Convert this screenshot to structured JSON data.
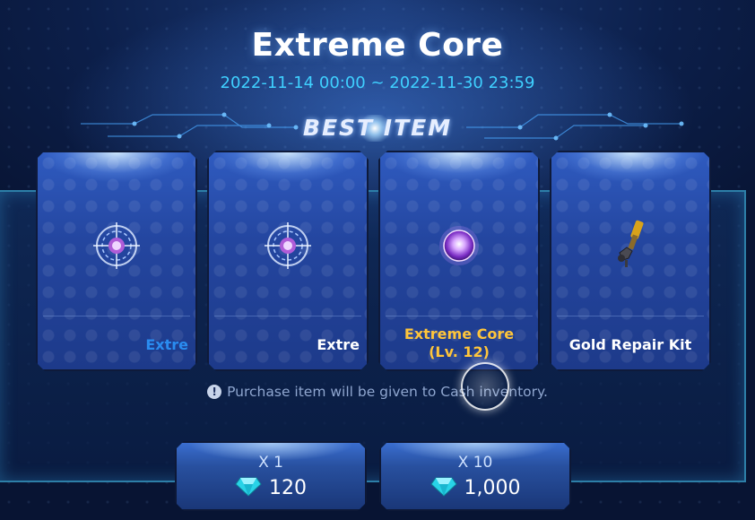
{
  "event": {
    "title": "Extreme Core",
    "period": "2022-11-14 00:00 ~ 2022-11-30 23:59",
    "section_heading": "BEST ITEM"
  },
  "items": [
    {
      "name": "Extre",
      "icon": "core-emblem-icon",
      "name_color": "#2a8cf0"
    },
    {
      "name": "Extre",
      "icon": "core-emblem-icon",
      "name_color": "#ffffff"
    },
    {
      "name": "Extreme Core (Lv. 12)",
      "icon": "purple-orb-icon",
      "name_color": "#ffc53a"
    },
    {
      "name": "Gold Repair Kit",
      "icon": "repair-kit-icon",
      "name_color": "#ffffff"
    }
  ],
  "notice": "Purchase item will be given to Cash inventory.",
  "purchase_options": [
    {
      "quantity": "X 1",
      "price": "120",
      "currency_icon": "diamond-gem-icon"
    },
    {
      "quantity": "X 10",
      "price": "1,000",
      "currency_icon": "diamond-gem-icon"
    }
  ],
  "colors": {
    "accent": "#3fd0ff",
    "highlight_item": "#ffc53a",
    "frame_border": "#2d7fa8"
  }
}
